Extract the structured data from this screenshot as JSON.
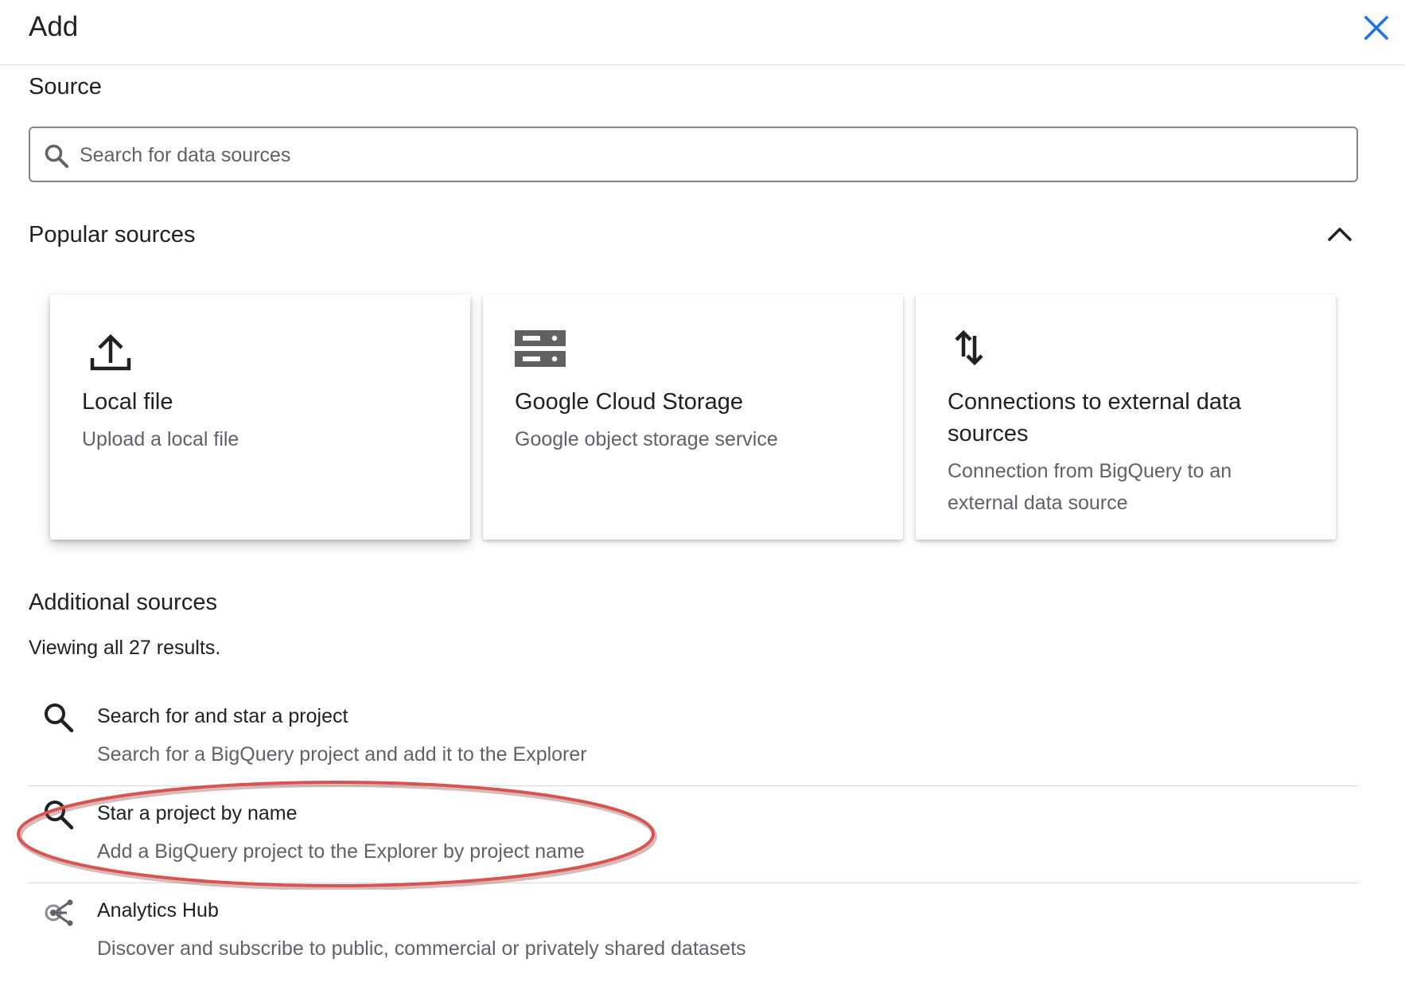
{
  "header": {
    "title": "Add"
  },
  "source": {
    "heading": "Source",
    "search_placeholder": "Search for data sources"
  },
  "popular": {
    "heading": "Popular sources",
    "cards": [
      {
        "icon": "upload-icon",
        "title": "Local file",
        "description": "Upload a local file"
      },
      {
        "icon": "storage-icon",
        "title": "Google Cloud Storage",
        "description": "Google object storage service"
      },
      {
        "icon": "sync-arrows-icon",
        "title": "Connections to external data sources",
        "description": "Connection from BigQuery to an external data source"
      }
    ]
  },
  "additional": {
    "heading": "Additional sources",
    "results_text": "Viewing all 27 results.",
    "items": [
      {
        "icon": "search-icon",
        "title": "Search for and star a project",
        "description": "Search for a BigQuery project and add it to the Explorer"
      },
      {
        "icon": "search-icon",
        "title": "Star a project by name",
        "description": "Add a BigQuery project to the Explorer by project name"
      },
      {
        "icon": "analytics-hub-icon",
        "title": "Analytics Hub",
        "description": "Discover and subscribe to public, commercial or privately shared datasets"
      }
    ]
  },
  "colors": {
    "close_icon": "#1a73e8",
    "highlight_ring": "#d9534f",
    "text_primary": "#202124",
    "text_secondary": "#5f6368"
  }
}
